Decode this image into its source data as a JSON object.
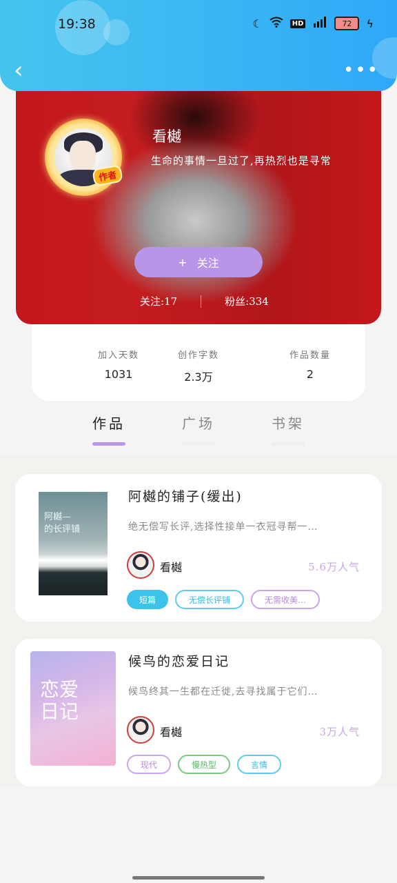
{
  "status": {
    "time": "19:38",
    "battery": "72"
  },
  "profile": {
    "badge": "作者",
    "name": "看樾",
    "bio": "生命的事情一旦过了,再热烈也是寻常",
    "follow_label": "关注",
    "following": "关注:17",
    "fans": "粉丝:334"
  },
  "stats": [
    {
      "label": "加入天数",
      "value": "1031"
    },
    {
      "label": "创作字数",
      "value": "2.3万"
    },
    {
      "label": "作品数量",
      "value": "2"
    }
  ],
  "tabs": [
    "作品",
    "广场",
    "书架"
  ],
  "books": [
    {
      "title": "阿樾的铺子(缓出)",
      "cover_text": "阿樾—\n的长评铺",
      "desc": "绝无偿写长评,选择性接单一衣冠寻帮一…",
      "author": "看樾",
      "popularity": "5.6万人气",
      "tags": [
        {
          "text": "短篇",
          "style": "fill"
        },
        {
          "text": "无偿长评铺",
          "style": "blue"
        },
        {
          "text": "无需收美…",
          "style": "purple"
        }
      ]
    },
    {
      "title": "候鸟的恋爱日记",
      "cover_text": "恋爱\n日记",
      "desc": "候鸟终其一生都在迁徙,去寻找属于它们…",
      "author": "看樾",
      "popularity": "3万人气",
      "tags": [
        {
          "text": "现代",
          "style": "purple"
        },
        {
          "text": "慢热型",
          "style": "green"
        },
        {
          "text": "言情",
          "style": "blue"
        }
      ]
    }
  ]
}
